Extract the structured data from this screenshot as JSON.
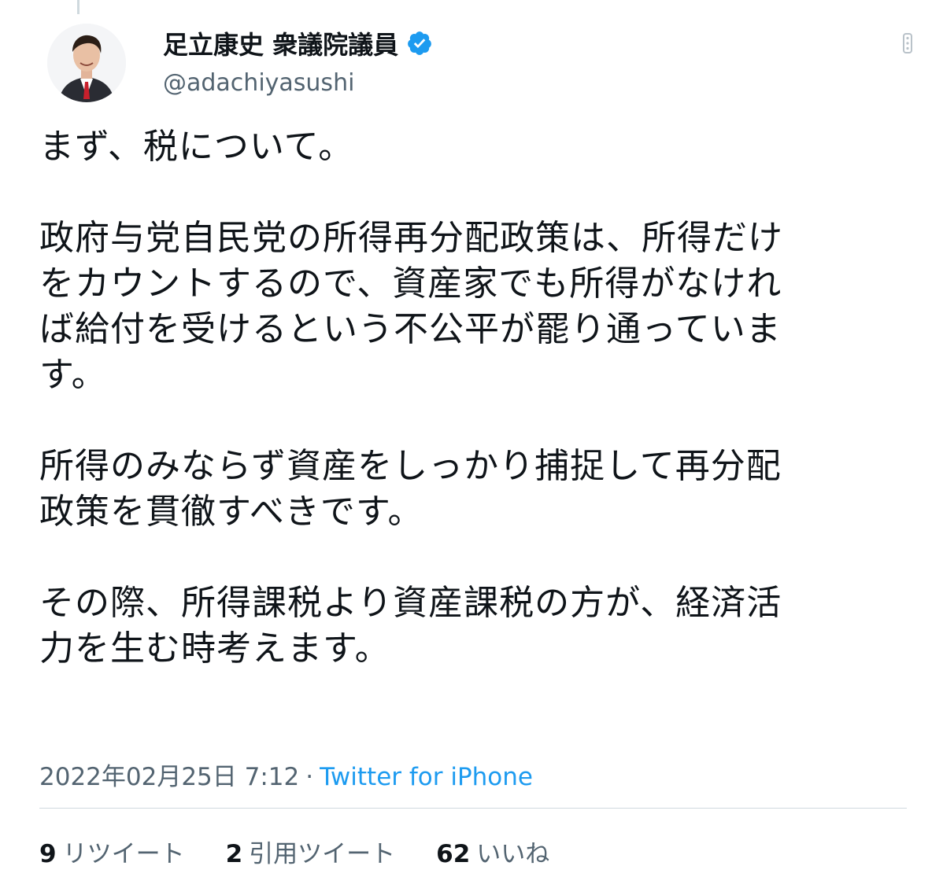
{
  "author": {
    "display_name": "足立康史 衆議院議員",
    "handle": "@adachiyasushi",
    "verified_icon": "verified-badge",
    "avatar": "profile-photo"
  },
  "tweet": {
    "lines": [
      "まず、税について。",
      "",
      "政府与党自民党の所得再分配政策は、所得だけ",
      "をカウントするので、資産家でも所得がなけれ",
      "ば給付を受けるという不公平が罷り通っていま",
      "す。",
      "",
      "所得のみならず資産をしっかり捕捉して再分配",
      "政策を貫徹すべきです。",
      "",
      "その際、所得課税より資産課税の方が、経済活",
      "力を生む時考えます。"
    ],
    "timestamp": "2022年02月25日 7:12",
    "separator": "·",
    "source": "Twitter for iPhone"
  },
  "stats": {
    "retweets": {
      "count": "9",
      "label": "リツイート"
    },
    "quotes": {
      "count": "2",
      "label": "引用ツイート"
    },
    "likes": {
      "count": "62",
      "label": "いいね"
    }
  },
  "colors": {
    "text": "#0f1419",
    "secondary": "#536471",
    "accent": "#1d9bf0",
    "divider": "#cfd9de"
  },
  "icons": {
    "more": "more-options-icon"
  }
}
